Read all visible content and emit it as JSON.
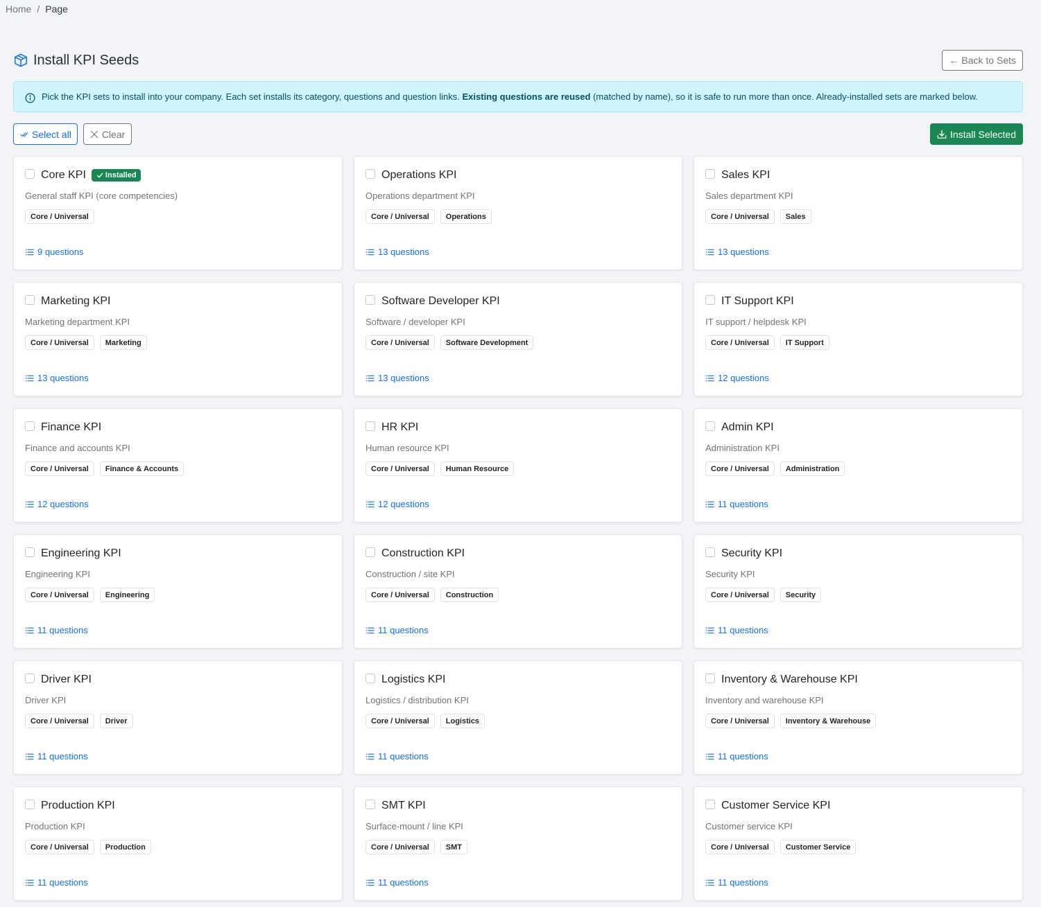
{
  "breadcrumb": {
    "home": "Home",
    "separator": "/",
    "current": "Page"
  },
  "header": {
    "title": "Install KPI Seeds",
    "title_icon": "box-icon",
    "back_label": "Back to Sets"
  },
  "alert": {
    "icon": "info-icon",
    "text_before": "Pick the KPI sets to install into your company. Each set installs its category, questions and question links. ",
    "text_bold": "Existing questions are reused",
    "text_after": " (matched by name), so it is safe to run more than once. Already-installed sets are marked below."
  },
  "toolbar": {
    "select_all_label": "Select all",
    "clear_label": "Clear",
    "install_label": "Install Selected"
  },
  "colors": {
    "primary": "#0d6efd",
    "success": "#198754",
    "info_bg": "#cff4fc",
    "info_text": "#055160"
  },
  "installed_label": "Installed",
  "cards": [
    {
      "title": "Core KPI",
      "installed": true,
      "desc": "General staff KPI (core competencies)",
      "tags": [
        "Core / Universal"
      ],
      "questions": "9 questions"
    },
    {
      "title": "Operations KPI",
      "installed": false,
      "desc": "Operations department KPI",
      "tags": [
        "Core / Universal",
        "Operations"
      ],
      "questions": "13 questions"
    },
    {
      "title": "Sales KPI",
      "installed": false,
      "desc": "Sales department KPI",
      "tags": [
        "Core / Universal",
        "Sales"
      ],
      "questions": "13 questions"
    },
    {
      "title": "Marketing KPI",
      "installed": false,
      "desc": "Marketing department KPI",
      "tags": [
        "Core / Universal",
        "Marketing"
      ],
      "questions": "13 questions"
    },
    {
      "title": "Software Developer KPI",
      "installed": false,
      "desc": "Software / developer KPI",
      "tags": [
        "Core / Universal",
        "Software Development"
      ],
      "questions": "13 questions"
    },
    {
      "title": "IT Support KPI",
      "installed": false,
      "desc": "IT support / helpdesk KPI",
      "tags": [
        "Core / Universal",
        "IT Support"
      ],
      "questions": "12 questions"
    },
    {
      "title": "Finance KPI",
      "installed": false,
      "desc": "Finance and accounts KPI",
      "tags": [
        "Core / Universal",
        "Finance & Accounts"
      ],
      "questions": "12 questions"
    },
    {
      "title": "HR KPI",
      "installed": false,
      "desc": "Human resource KPI",
      "tags": [
        "Core / Universal",
        "Human Resource"
      ],
      "questions": "12 questions"
    },
    {
      "title": "Admin KPI",
      "installed": false,
      "desc": "Administration KPI",
      "tags": [
        "Core / Universal",
        "Administration"
      ],
      "questions": "11 questions"
    },
    {
      "title": "Engineering KPI",
      "installed": false,
      "desc": "Engineering KPI",
      "tags": [
        "Core / Universal",
        "Engineering"
      ],
      "questions": "11 questions"
    },
    {
      "title": "Construction KPI",
      "installed": false,
      "desc": "Construction / site KPI",
      "tags": [
        "Core / Universal",
        "Construction"
      ],
      "questions": "11 questions"
    },
    {
      "title": "Security KPI",
      "installed": false,
      "desc": "Security KPI",
      "tags": [
        "Core / Universal",
        "Security"
      ],
      "questions": "11 questions"
    },
    {
      "title": "Driver KPI",
      "installed": false,
      "desc": "Driver KPI",
      "tags": [
        "Core / Universal",
        "Driver"
      ],
      "questions": "11 questions"
    },
    {
      "title": "Logistics KPI",
      "installed": false,
      "desc": "Logistics / distribution KPI",
      "tags": [
        "Core / Universal",
        "Logistics"
      ],
      "questions": "11 questions"
    },
    {
      "title": "Inventory & Warehouse KPI",
      "installed": false,
      "desc": "Inventory and warehouse KPI",
      "tags": [
        "Core / Universal",
        "Inventory & Warehouse"
      ],
      "questions": "11 questions"
    },
    {
      "title": "Production KPI",
      "installed": false,
      "desc": "Production KPI",
      "tags": [
        "Core / Universal",
        "Production"
      ],
      "questions": "11 questions"
    },
    {
      "title": "SMT KPI",
      "installed": false,
      "desc": "Surface-mount / line KPI",
      "tags": [
        "Core / Universal",
        "SMT"
      ],
      "questions": "11 questions"
    },
    {
      "title": "Customer Service KPI",
      "installed": false,
      "desc": "Customer service KPI",
      "tags": [
        "Core / Universal",
        "Customer Service"
      ],
      "questions": "11 questions"
    }
  ]
}
